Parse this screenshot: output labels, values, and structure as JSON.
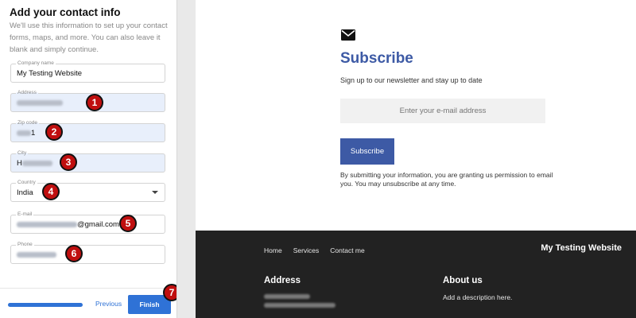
{
  "wizard": {
    "title": "Add your contact info",
    "description": "We'll use this information to set up your contact forms, maps, and more. You can also leave it blank and simply continue.",
    "fields": {
      "company": {
        "label": "Company name",
        "value": "My Testing Website"
      },
      "address": {
        "label": "Address"
      },
      "zip": {
        "label": "Zip code",
        "value_visible": "1"
      },
      "city": {
        "label": "City",
        "value_visible": "H"
      },
      "country": {
        "label": "Country",
        "value": "India"
      },
      "email": {
        "label": "E-mail",
        "value_visible": "@gmail.com"
      },
      "phone": {
        "label": "Phone"
      }
    },
    "progress": 0.95,
    "previous_label": "Previous",
    "finish_label": "Finish"
  },
  "badges": [
    "1",
    "2",
    "3",
    "4",
    "5",
    "6",
    "7"
  ],
  "preview": {
    "icon": "envelope-icon",
    "subscribe_title": "Subscribe",
    "subscribe_desc": "Sign up to our newsletter and stay up to date",
    "email_placeholder": "Enter your e-mail address",
    "subscribe_button": "Subscribe",
    "consent": "By submitting your information, you are granting us permission to email you. You may unsubscribe at any time.",
    "footer": {
      "nav": [
        "Home",
        "Services",
        "Contact me"
      ],
      "brand": "My Testing Website",
      "address_heading": "Address",
      "about_heading": "About us",
      "about_desc": "Add a description here."
    }
  },
  "colors": {
    "accent": "#2f72d6",
    "subscribe_blue": "#3d5aa5",
    "footer_bg": "#222222",
    "badge_red": "#c00f0f",
    "filled_field": "#e8effb"
  }
}
